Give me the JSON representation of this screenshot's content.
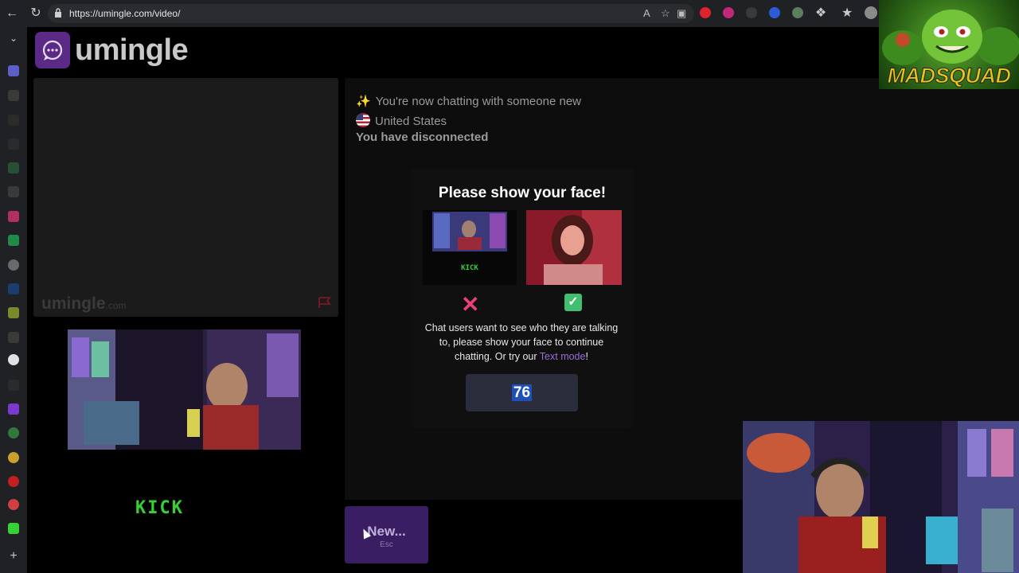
{
  "browser": {
    "url": "https://umingle.com/video/"
  },
  "app": {
    "logo_text": "umingle",
    "watermark_main": "umingle",
    "watermark_suffix": ".com",
    "kick_text": "KICK"
  },
  "chat": {
    "line1": "You're now chatting with someone new",
    "country": "United States",
    "line3": "You have disconnected"
  },
  "modal": {
    "title": "Please show your face!",
    "message_part1": "Chat users want to see who they are talking to, please show your face to continue chatting. Or try our ",
    "link_text": "Text mode",
    "message_part2": "!",
    "counter": "76",
    "example_kick": "KICK"
  },
  "new_button": {
    "label": "New...",
    "shortcut": "Esc"
  },
  "overlay": {
    "brand": "MADSQUAD"
  },
  "colors": {
    "accent": "#5a2a86",
    "link": "#9b6cd6",
    "kick_green": "#35d135",
    "counter_bg": "#2b2d3d"
  }
}
